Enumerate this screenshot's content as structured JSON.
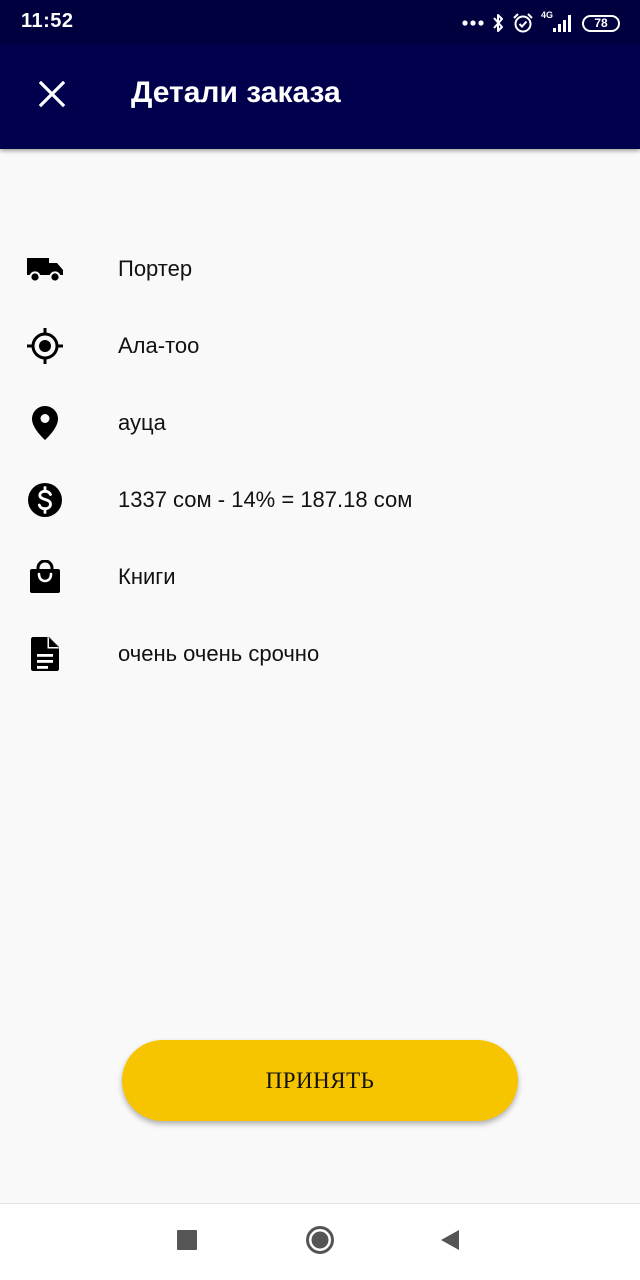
{
  "status_bar": {
    "time": "11:52",
    "network_label": "4G",
    "battery": "78",
    "icons": [
      "more-dots-icon",
      "bluetooth-icon",
      "alarm-icon",
      "signal-icon",
      "battery-icon"
    ]
  },
  "app_bar": {
    "title": "Детали заказа",
    "close_icon": "close-icon",
    "background": "#00004d"
  },
  "details": [
    {
      "icon": "truck-icon",
      "text": "Портер"
    },
    {
      "icon": "crosshair-icon",
      "text": "Ала-тоо"
    },
    {
      "icon": "location-pin-icon",
      "text": "ауца"
    },
    {
      "icon": "dollar-icon",
      "text": "1337 сом - 14% = 187.18 сом"
    },
    {
      "icon": "shopping-bag-icon",
      "text": "Книги"
    },
    {
      "icon": "document-icon",
      "text": "очень очень срочно"
    }
  ],
  "accept_button": {
    "label": "ПРИНЯТЬ",
    "color": "#f7c400"
  },
  "nav_bar": {
    "icons": [
      "recents-square-icon",
      "home-circle-icon",
      "back-triangle-icon"
    ]
  }
}
